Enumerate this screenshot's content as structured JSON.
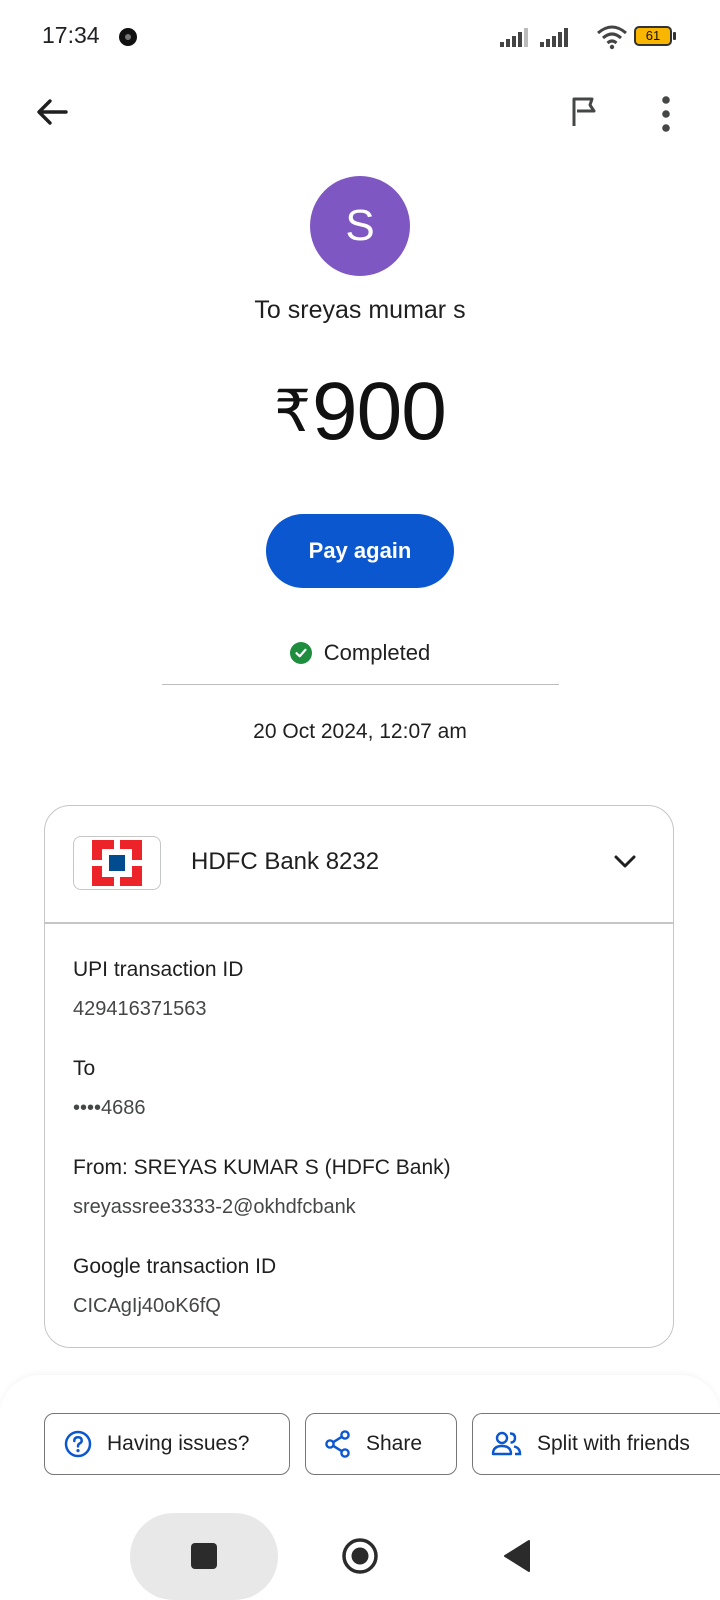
{
  "status_bar": {
    "time": "17:34",
    "battery": "61"
  },
  "top_bar": {
    "back_icon": "arrow-back-icon",
    "flag_icon": "flag-icon",
    "more_icon": "more-vert-icon"
  },
  "payee": {
    "initial": "S",
    "label": "To sreyas mumar s",
    "avatar_color": "#7e57c2"
  },
  "amount": {
    "currency": "₹",
    "value": "900"
  },
  "pay_again_label": "Pay again",
  "status": {
    "label": "Completed",
    "color": "#1e8e3e"
  },
  "date": "20 Oct 2024, 12:07 am",
  "bank": {
    "name": "HDFC Bank 8232"
  },
  "details": [
    {
      "label": "UPI transaction ID",
      "value": "429416371563"
    },
    {
      "label": "To",
      "value": "••••4686"
    },
    {
      "label": "From: SREYAS KUMAR S (HDFC Bank)",
      "value": "sreyassree3333-2@okhdfcbank"
    },
    {
      "label": "Google transaction ID",
      "value": "CICAgIj40oK6fQ"
    }
  ],
  "actions": {
    "issues_label": "Having issues?",
    "share_label": "Share",
    "split_label": "Split with friends"
  },
  "colors": {
    "accent": "#0b57d0"
  }
}
